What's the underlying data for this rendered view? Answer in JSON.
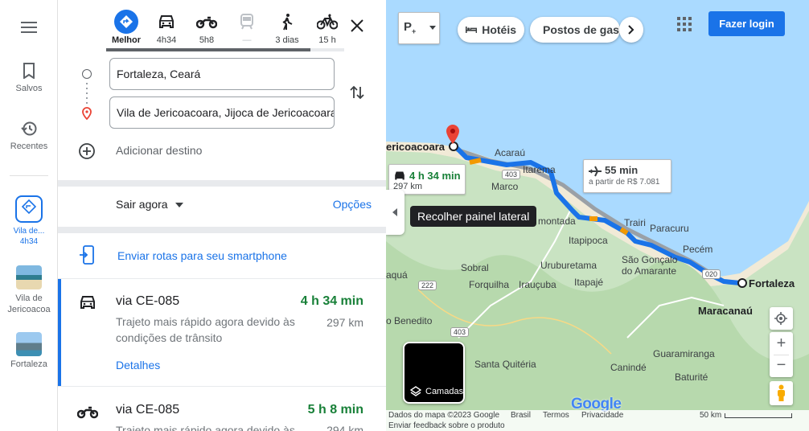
{
  "rail": {
    "saved_label": "Salvos",
    "recent_label": "Recentes",
    "recent_items": [
      {
        "label": "Vila de... 4h34"
      },
      {
        "label": "Vila de Jericoacoa"
      },
      {
        "label": "Fortaleza"
      }
    ],
    "recent_item_lines": {
      "a1": "Vila de...",
      "a2": "4h34",
      "b1": "Vila de",
      "b2": "Jericoacoa",
      "c1": "Fortaleza"
    }
  },
  "modes": {
    "best": {
      "label": "Melhor"
    },
    "car": {
      "label": "4h34"
    },
    "moto": {
      "label": "5h8"
    },
    "transit": {
      "label": "—"
    },
    "walk": {
      "label": "3 dias"
    },
    "bike": {
      "label": "15 h"
    }
  },
  "directions": {
    "origin": "Fortaleza, Ceará",
    "destination": "Vila de Jericoacoara, Jijoca de Jericoacoara",
    "add_destination": "Adicionar destino",
    "leave_now": "Sair agora",
    "options": "Opções",
    "send_to_phone": "Enviar rotas para seu smartphone"
  },
  "routes": [
    {
      "via": "via CE-085",
      "time": "4 h 34 min",
      "desc": "Trajeto mais rápido agora devido às condições de trânsito",
      "distance": "297 km",
      "details": "Detalhes"
    },
    {
      "via": "via CE-085",
      "time": "5 h 8 min",
      "desc": "Trajeto mais rápido agora devido às",
      "distance": "294 km"
    }
  ],
  "map": {
    "chips": {
      "hotels": "Hotéis",
      "gas": "Postos de gas"
    },
    "login": "Fazer login",
    "tooltip": "Recolher painel lateral",
    "layers": "Camadas",
    "car_box": {
      "time": "4 h 34 min",
      "distance": "297 km"
    },
    "flight_box": {
      "time": "55 min",
      "price": "a partir de R$ 7.081"
    },
    "places": {
      "jeri": "ericoacoara",
      "acarau": "Acaraú",
      "marco": "Marco",
      "itarema": "Itarema",
      "amontada": "montada",
      "trairi": "Trairi",
      "paracuru": "Paracuru",
      "itapipoca": "Itapipoca",
      "pecem": "Pecém",
      "sgoncalo1": "São Gonçalo",
      "sgoncalo2": "do Amarante",
      "fortaleza": "Fortaleza",
      "maracanau": "Maracanaú",
      "sobral": "Sobral",
      "uruburetama": "Uruburetama",
      "forquilha": "Forquilha",
      "iraucuba": "Irauçuba",
      "itapaje": "Itapajé",
      "aqua": "aquá",
      "benedito": "o Benedito",
      "santaquiteria": "Santa Quitéria",
      "caninde": "Canindé",
      "guaramiranga": "Guaramiranga",
      "baturite": "Baturité"
    },
    "road_labels": {
      "r403a": "403",
      "r222": "222",
      "r403b": "403",
      "r020": "020"
    },
    "logo": "Google",
    "footer": {
      "data": "Dados do mapa ©2023 Google",
      "country": "Brasil",
      "terms": "Termos",
      "privacy": "Privacidade",
      "feedback": "Enviar feedback sobre o produto",
      "scale": "50 km"
    }
  },
  "colors": {
    "accent": "#1a73e8",
    "route": "#1a73e8",
    "time_green": "#188038"
  }
}
